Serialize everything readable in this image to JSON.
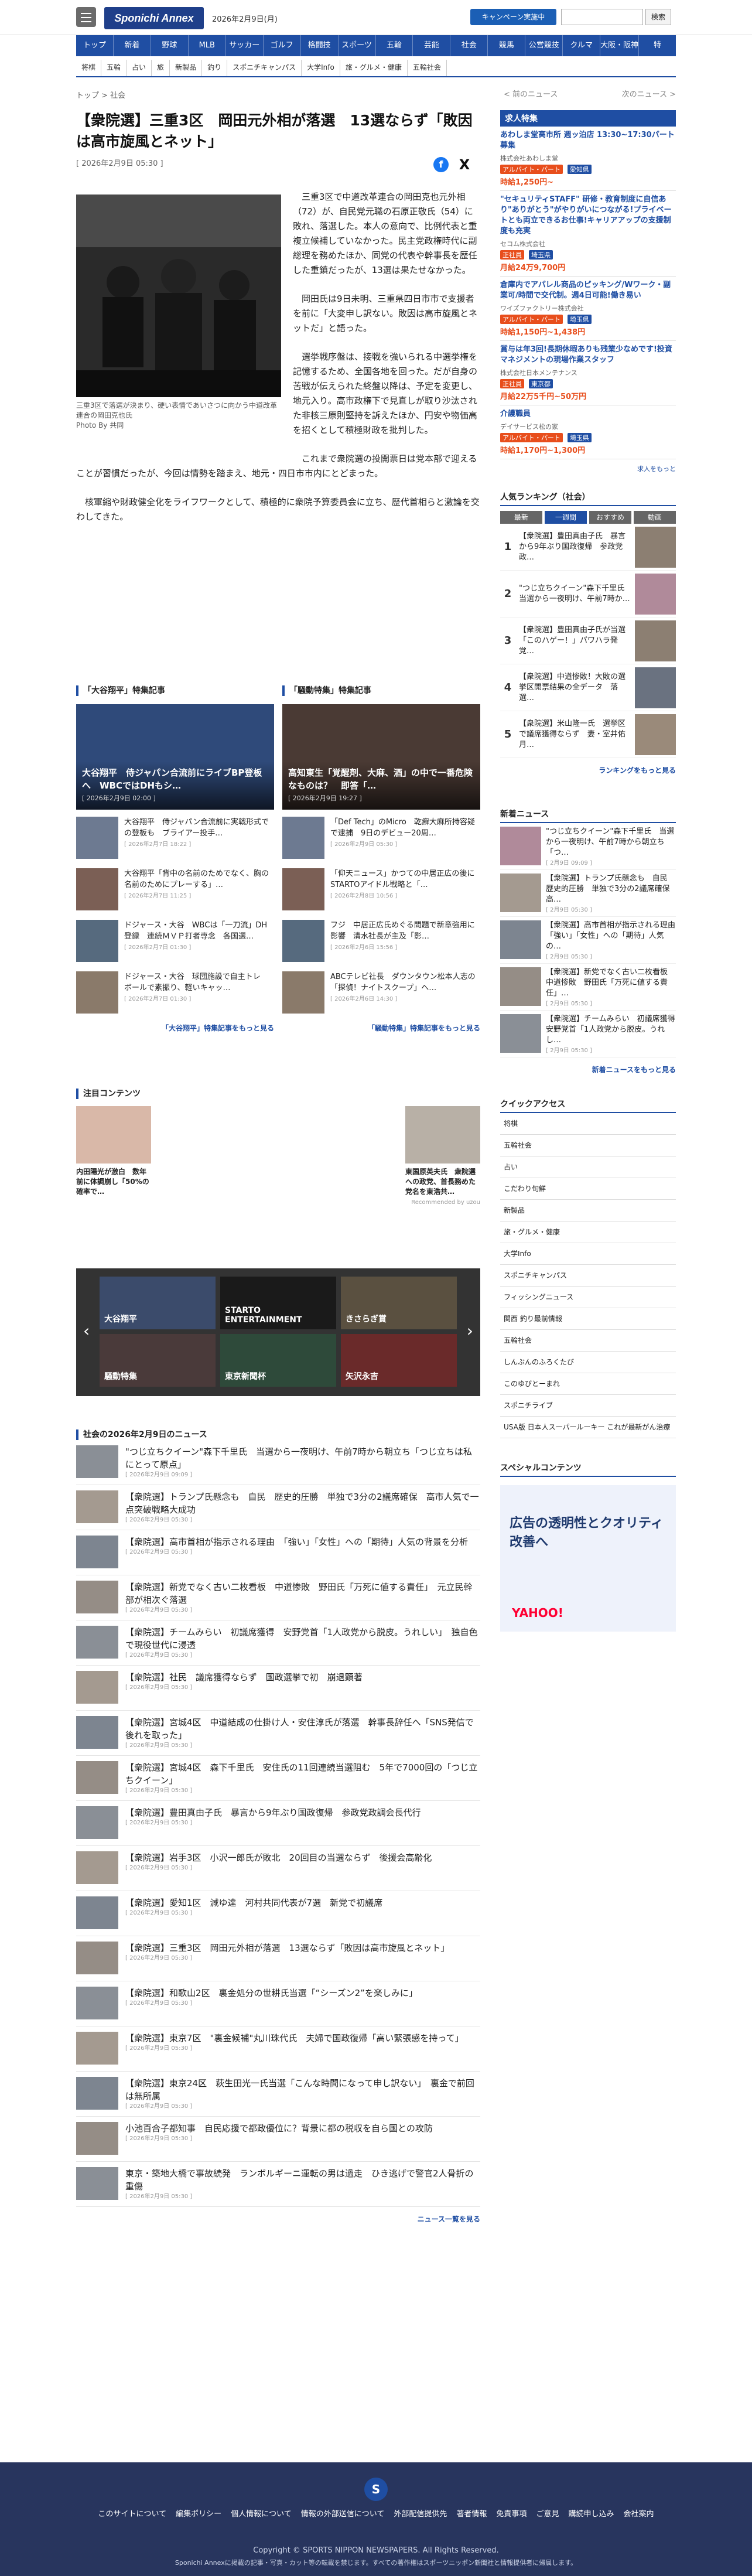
{
  "header": {
    "logo": "Sponichi Annex",
    "date": "2026年2月9日(月)",
    "campaign": "キャンペーン実施中",
    "search_placeholder": "",
    "search_button": "検索"
  },
  "nav1": [
    "トップ",
    "新着",
    "野球",
    "MLB",
    "サッカー",
    "ゴルフ",
    "格闘技",
    "スポーツ",
    "五輪",
    "芸能",
    "社会",
    "競馬",
    "公営競技",
    "クルマ",
    "大阪・阪神",
    "特"
  ],
  "nav2": [
    "将棋",
    "五輪",
    "占い",
    "旅",
    "新製品",
    "釣り",
    "スポニチキャンパス",
    "大学Info",
    "旅・グルメ・健康",
    "五輪社会"
  ],
  "breadcrumb": "トップ > 社会",
  "pager": {
    "prev": "< 前のニュース",
    "next": "次のニュース >"
  },
  "article": {
    "title": "【衆院選】三重3区　岡田元外相が落選　13選ならず「敗因は高市旋風とネット」",
    "date": "[ 2026年2月9日 05:30 ]",
    "caption": "三重3区で落選が決まり、硬い表情であいさつに向かう中道改革連合の岡田克也氏",
    "credit": "Photo By 共同",
    "paragraphs": [
      "三重3区で中道改革連合の岡田克也元外相（72）が、自民党元職の石原正敬氏（54）に敗れ、落選した。本人の意向で、比例代表と重複立候補していなかった。民主党政権時代に副総理を務めたほか、同党の代表や幹事長を歴任した重鎮だったが、13選は果たせなかった。",
      "岡田氏は9日未明、三重県四日市市で支援者を前に「大変申し訳ない。敗因は高市旋風とネットだ」と語った。",
      "選挙戦序盤は、接戦を強いられる中選挙権を記憶するため、全国各地を回った。だが自身の苦戦が伝えられた終盤以降は、予定を変更し、地元入り。高市政権下で見直しが取り沙汰された非核三原則堅持を訴えたほか、円安や物価高を招くとして積極財政を批判した。",
      "これまで衆院選の投開票日は党本部で迎えることが習慣だったが、今回は情勢を踏まえ、地元・四日市市内にとどまった。",
      "核軍縮や財政健全化をライフワークとして、積極的に衆院予算委員会に立ち、歴代首相らと激論を交わしてきた。"
    ],
    "share": {
      "facebook": "f",
      "x": "X"
    }
  },
  "feature1": {
    "title": "「大谷翔平」特集記事",
    "hero": "大谷翔平　侍ジャパン合流前にライブBP登板へ　WBCではDHもシ…",
    "hero_date": "[ 2026年2月9日 02:00 ]",
    "items": [
      {
        "t": "大谷翔平　侍ジャパン合流前に実戦形式での登板も　ブライアー投手…",
        "d": "[ 2026年2月7日 18:22 ]"
      },
      {
        "t": "大谷翔平「背中の名前のためでなく、胸の名前のためにプレーする」…",
        "d": "[ 2026年2月7日 11:25 ]"
      },
      {
        "t": "ドジャース・大谷　WBCは「一刀流」DH登録　連続ＭＶＰ打者専念　各国選…",
        "d": "[ 2026年2月7日 01:30 ]"
      },
      {
        "t": "ドジャース・大谷　球団施設で自主トレ　ボールで素振り、軽いキャッ…",
        "d": "[ 2026年2月7日 01:30 ]"
      }
    ],
    "more": "「大谷翔平」特集記事をもっと見る"
  },
  "feature2": {
    "title": "「騒動特集」特集記事",
    "hero": "高知東生「覚醒剤、大麻、酒」の中で一番危険なものは？　即答「…",
    "hero_date": "[ 2026年2月9日 19:27 ]",
    "items": [
      {
        "t": "「Def Tech」のMicro　乾癬大麻所持容疑で逮捕　9日のデビュー20周…",
        "d": "[ 2026年2月9日 05:30 ]"
      },
      {
        "t": "「仰天ニュース」かつての中居正広の後にSTARTOアイドル戦略と「…",
        "d": "[ 2026年2月8日 10:56 ]"
      },
      {
        "t": "フジ　中居正広氏めぐる問題で新章強用に影響　清水社長が主及「影…",
        "d": "[ 2026年2月6日 15:56 ]"
      },
      {
        "t": "ABCテレビ社長　ダウンタウン松本人志の「探偵！ナイトスクープ」へ…",
        "d": "[ 2026年2月6日 14:30 ]"
      }
    ],
    "more": "「騒動特集」特集記事をもっと見る"
  },
  "attention": {
    "title": "注目コンテンツ",
    "items": [
      {
        "t": "内田陽光が激白　数年前に体調崩し「50%の確率で…"
      },
      {
        "t": ""
      },
      {
        "t": ""
      },
      {
        "t": ""
      },
      {
        "t": "東国原英夫氏　衆院選への政党、首長務めた　党名を東浩共…"
      }
    ],
    "recommended": "Recommended by uzou"
  },
  "banner": [
    "大谷翔平",
    "STARTO ENTERTAINMENT",
    "きさらぎ賞",
    "騒動特集",
    "東京新聞杯",
    "矢沢永吉"
  ],
  "list": {
    "title": "社会の2026年2月9日のニュース",
    "items": [
      {
        "t": "\"つじ立ちクイーン\"森下千里氏　当選から一夜明け、午前7時から朝立ち「つじ立ちは私にとって原点」",
        "d": "[ 2026年2月9日 09:09 ]"
      },
      {
        "t": "【衆院選】トランプ氏懸念も　自民　歴史的圧勝　単独で3分の2議席確保　高市人気で一点突破戦略大成功",
        "d": "[ 2026年2月9日 05:30 ]"
      },
      {
        "t": "【衆院選】高市首相が指示される理由　「強い」「女性」への「期待」人気の背景を分析",
        "d": "[ 2026年2月9日 05:30 ]"
      },
      {
        "t": "【衆院選】新党でなく古い二枚看板　中道惨敗　野田氏「万死に値する責任」　元立民幹部が相次ぐ落選",
        "d": "[ 2026年2月9日 05:30 ]"
      },
      {
        "t": "【衆院選】チームみらい　初議席獲得　安野党首「1人政党から脱皮。うれしい」　独自色で現役世代に浸透",
        "d": "[ 2026年2月9日 05:30 ]"
      },
      {
        "t": "【衆院選】社民　議席獲得ならず　国政選挙で初　崩退顕著",
        "d": "[ 2026年2月9日 05:30 ]"
      },
      {
        "t": "【衆院選】宮城4区　中道結成の仕掛け人・安住淳氏が落選　幹事長辞任へ「SNS発信で後れを取った」",
        "d": "[ 2026年2月9日 05:30 ]"
      },
      {
        "t": "【衆院選】宮城4区　森下千里氏　安住氏の11回連続当選阻む　5年で7000回の「つじ立ちクイーン」",
        "d": "[ 2026年2月9日 05:30 ]"
      },
      {
        "t": "【衆院選】豊田真由子氏　暴言から9年ぶり国政復帰　参政党政調会長代行",
        "d": "[ 2026年2月9日 05:30 ]"
      },
      {
        "t": "【衆院選】岩手3区　小沢一郎氏が敗北　20回目の当選ならず　後援会高齢化",
        "d": "[ 2026年2月9日 05:30 ]"
      },
      {
        "t": "【衆院選】愛知1区　減ゆ達　河村共同代表が7選　新党で初議席",
        "d": "[ 2026年2月9日 05:30 ]"
      },
      {
        "t": "【衆院選】三重3区　岡田元外相が落選　13選ならず「敗因は高市旋風とネット」",
        "d": "[ 2026年2月9日 05:30 ]"
      },
      {
        "t": "【衆院選】和歌山2区　裏金処分の世耕氏当選「“シーズン2”を楽しみに」",
        "d": "[ 2026年2月9日 05:30 ]"
      },
      {
        "t": "【衆院選】東京7区　\"裏金候補\"丸川珠代氏　夫婦で国政復帰「高い緊張感を持って」",
        "d": "[ 2026年2月9日 05:30 ]"
      },
      {
        "t": "【衆院選】東京24区　萩生田光一氏当選「こんな時間になって申し訳ない」　裏金で前回は無所属",
        "d": "[ 2026年2月9日 05:30 ]"
      },
      {
        "t": "小池百合子都知事　自民応援で都政優位に？背景に都の税収を自ら国との攻防",
        "d": "[ 2026年2月9日 05:30 ]"
      },
      {
        "t": "東京・築地大橋で事故続発　ランボルギーニ運転の男は過走　ひき逃げで警官2人骨折の重傷",
        "d": "[ 2026年2月9日 05:30 ]"
      }
    ],
    "more": "ニュース一覧を見る"
  },
  "side": {
    "jobs_title": "求人特集",
    "jobs": [
      {
        "t": "あわしま堂高市所 週ッ泊店 13:30~17:30パート募集",
        "c": "株式会社あわしま堂",
        "tag": "アルバイト・パート",
        "loc": "愛知県",
        "p": "時給1,250円~"
      },
      {
        "t": "\"セキュリティSTAFF\" 研修・教育制度に自信あり\"ありがとう\"がやりがいにつながる!プライベートとも両立できるお仕事!キャリアアップの支援制度も充実",
        "c": "セコム株式会社",
        "tag": "正社員",
        "loc": "埼玉県",
        "p": "月給24万9,700円"
      },
      {
        "t": "倉庫内でアパレル商品のピッキング/Wワーク・副業可/時間で交代制。週4日可能!働き易い",
        "c": "ワイズファクトリー株式会社",
        "tag": "アルバイト・パート",
        "loc": "埼玉県",
        "p": "時給1,150円~1,438円"
      },
      {
        "t": "賞与は年3回!長期休暇ありも残業少なめです!投資マネジメントの現場作業スタッフ",
        "c": "株式会社日本メンテナンス",
        "tag": "正社員",
        "loc": "東京都",
        "p": "月給22万5千円~50万円"
      },
      {
        "t": "介護職員",
        "c": "デイサービス松の家",
        "tag": "アルバイト・パート",
        "loc": "埼玉県",
        "p": "時給1,170円~1,300円"
      }
    ],
    "jobs_more": "求人をもっと",
    "rank_title": "人気ランキング（社会）",
    "rank_tabs": [
      "最新",
      "一週間",
      "おすすめ",
      "動画"
    ],
    "ranks": [
      {
        "n": "1",
        "t": "【衆院選】豊田真由子氏　暴言から9年ぶり国政復帰　参政党政…"
      },
      {
        "n": "2",
        "t": "\"つじ立ちクイーン\"森下千里氏　当選から一夜明け、午前7時か…"
      },
      {
        "n": "3",
        "t": "【衆院選】豊田真由子氏が当選「このハゲー！」パワハラ発覚…"
      },
      {
        "n": "4",
        "t": "【衆院選】中道惨敗！大敗の選挙区開票結果の全データ　落選…"
      },
      {
        "n": "5",
        "t": "【衆院選】米山隆一氏　選挙区で議席獲得ならず　妻・室井佑月…"
      }
    ],
    "rank_more": "ランキングをもっと見る",
    "news_title": "新着ニュース",
    "news": [
      {
        "t": "\"つじ立ちクイーン\"森下千里氏　当選から一夜明け、午前7時から朝立ち「つ…",
        "d": "[ 2月9日 09:09 ]"
      },
      {
        "t": "【衆院選】トランプ氏懸念も　自民　歴史的圧勝　単独で3分の2議席確保　高…",
        "d": "[ 2月9日 05:30 ]"
      },
      {
        "t": "【衆院選】高市首相が指示される理由　「強い」「女性」への「期待」人気の…",
        "d": "[ 2月9日 05:30 ]"
      },
      {
        "t": "【衆院選】新党でなく古い二枚看板　中道惨敗　野田氏「万死に値する責任」…",
        "d": "[ 2月9日 05:30 ]"
      },
      {
        "t": "【衆院選】チームみらい　初議席獲得　安野党首「1人政党から脱皮。うれし…",
        "d": "[ 2月9日 05:30 ]"
      }
    ],
    "news_more": "新着ニュースをもっと見る",
    "quick_title": "クイックアクセス",
    "quick": [
      "将棋",
      "五輪社会",
      "占い",
      "こだわり旬鮮",
      "新製品",
      "旅・グルメ・健康",
      "大学Info",
      "スポニチキャンパス",
      "フィッシングニュース",
      "関西 釣り最前情報",
      "五輪社会",
      "しんぶんのふろくたび",
      "このゆびとーまれ",
      "スポニチライブ",
      "USA版 日本人スーパールーキー これが最新がん治療"
    ],
    "special_title": "スペシャルコンテンツ",
    "ad_text": "広告の透明性とクオリティ改善へ",
    "ad_brand": "YAHOO!"
  },
  "footer": {
    "links": [
      "このサイトについて",
      "編集ポリシー",
      "個人情報について",
      "情報の外部送信について",
      "外部配信提供先",
      "著者情報",
      "免責事項",
      "ご意見",
      "購読申し込み",
      "会社案内"
    ],
    "copyright": "Copyright © SPORTS NIPPON NEWSPAPERS. All Rights Reserved.",
    "note": "Sponichi Annexに掲載の記事・写真・カット等の転載を禁じます。すべての著作権はスポーツニッポン新聞社と情報提供者に帰属します。",
    "logo": "S"
  }
}
